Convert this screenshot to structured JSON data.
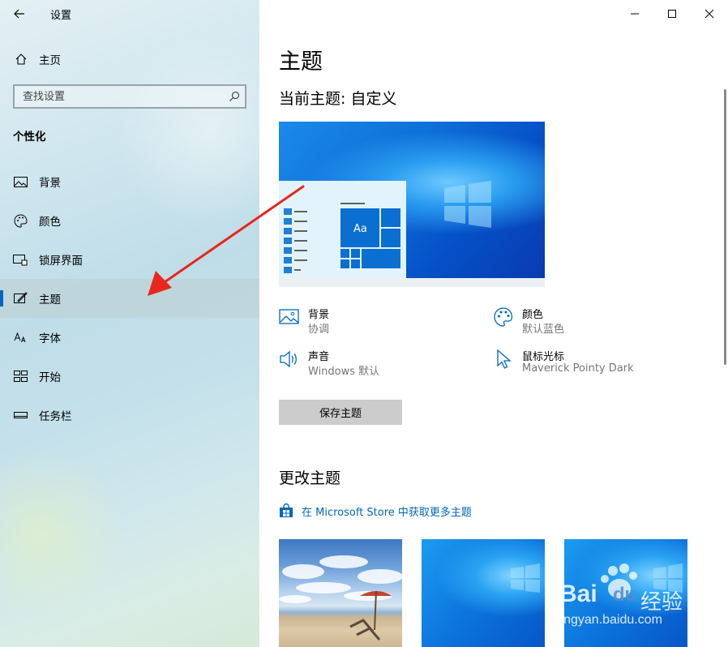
{
  "window": {
    "title": "设置"
  },
  "sidebar": {
    "home_label": "主页",
    "search_placeholder": "查找设置",
    "section": "个性化",
    "items": [
      {
        "label": "背景",
        "icon": "picture-icon"
      },
      {
        "label": "颜色",
        "icon": "palette-icon"
      },
      {
        "label": "锁屏界面",
        "icon": "lock-screen-icon"
      },
      {
        "label": "主题",
        "icon": "theme-brush-icon",
        "active": true
      },
      {
        "label": "字体",
        "icon": "font-icon"
      },
      {
        "label": "开始",
        "icon": "start-icon"
      },
      {
        "label": "任务栏",
        "icon": "taskbar-icon"
      }
    ]
  },
  "main": {
    "title": "主题",
    "current_theme": "当前主题: 自定义",
    "preview_tile_text": "Aa",
    "props": [
      {
        "name": "背景",
        "value": "协调",
        "icon": "picture-icon"
      },
      {
        "name": "颜色",
        "value": "默认蓝色",
        "icon": "palette-icon"
      },
      {
        "name": "声音",
        "value": "Windows 默认",
        "icon": "speaker-icon"
      },
      {
        "name": "鼠标光标",
        "value": "Maverick Pointy Dark",
        "icon": "cursor-icon"
      }
    ],
    "save_label": "保存主题",
    "change_title": "更改主题",
    "store_link": "在 Microsoft Store 中获取更多主题"
  },
  "watermark": {
    "brand_top": "Bai",
    "brand_mid": "du",
    "brand_cn": "经验",
    "url": "jingyan.baidu.com"
  },
  "colors": {
    "accent": "#0067c0",
    "sidebar_active": "#bfcdd2",
    "button": "#cccccc",
    "link": "#0067b8"
  }
}
